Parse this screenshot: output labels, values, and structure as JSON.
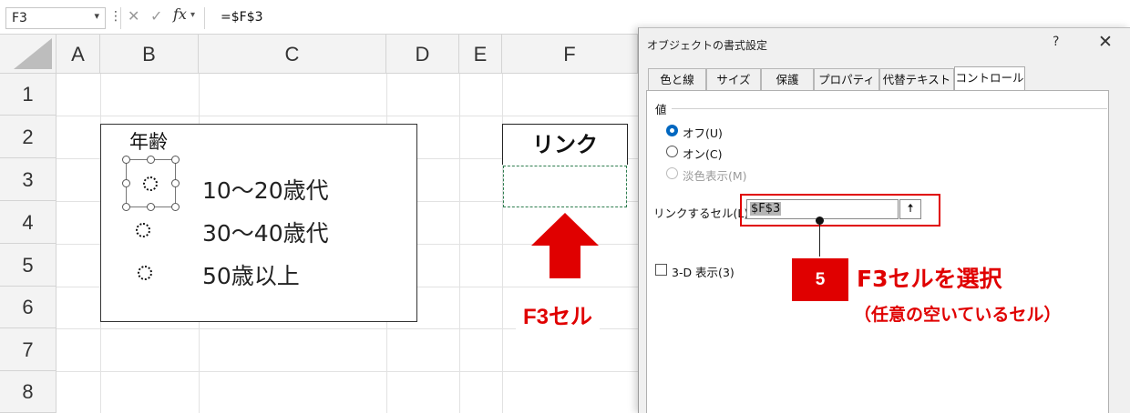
{
  "formula_bar": {
    "name_box": "F3",
    "dots": "⋮",
    "cancel_icon": "✕",
    "enter_icon": "✓",
    "fx": "fx",
    "formula": "=$F$3"
  },
  "sheet": {
    "columns": [
      "A",
      "B",
      "C",
      "D",
      "E",
      "F"
    ],
    "rows": [
      "1",
      "2",
      "3",
      "4",
      "5",
      "6",
      "7",
      "8"
    ],
    "group_label": "年齢",
    "options": [
      "10～20歳代",
      "30～40歳代",
      "50歳以上"
    ],
    "link_header": "リンク",
    "f3_label": "F3セル"
  },
  "dialog": {
    "title": "オブジェクトの書式設定",
    "help": "?",
    "close": "✕",
    "tabs": [
      "色と線",
      "サイズ",
      "保護",
      "プロパティ",
      "代替テキスト",
      "コントロール"
    ],
    "active_tab": "コントロール",
    "section_label": "値",
    "radios": [
      {
        "label": "オフ(U)",
        "state": "checked"
      },
      {
        "label": "オン(C)",
        "state": "unchecked"
      },
      {
        "label": "淡色表示(M)",
        "state": "disabled"
      }
    ],
    "link_cell_label": "リンクするセル(L):",
    "link_cell_value": "$F$3",
    "collapse_icon": "🠅",
    "checkbox_label": "3-D 表示(3)"
  },
  "callout": {
    "step": "5",
    "title": "F3セルを選択",
    "subtitle": "（任意の空いているセル）"
  },
  "colors": {
    "accent_red": "#e00000",
    "radio_blue": "#0067c0",
    "dashed_green": "#2e7d4f"
  }
}
